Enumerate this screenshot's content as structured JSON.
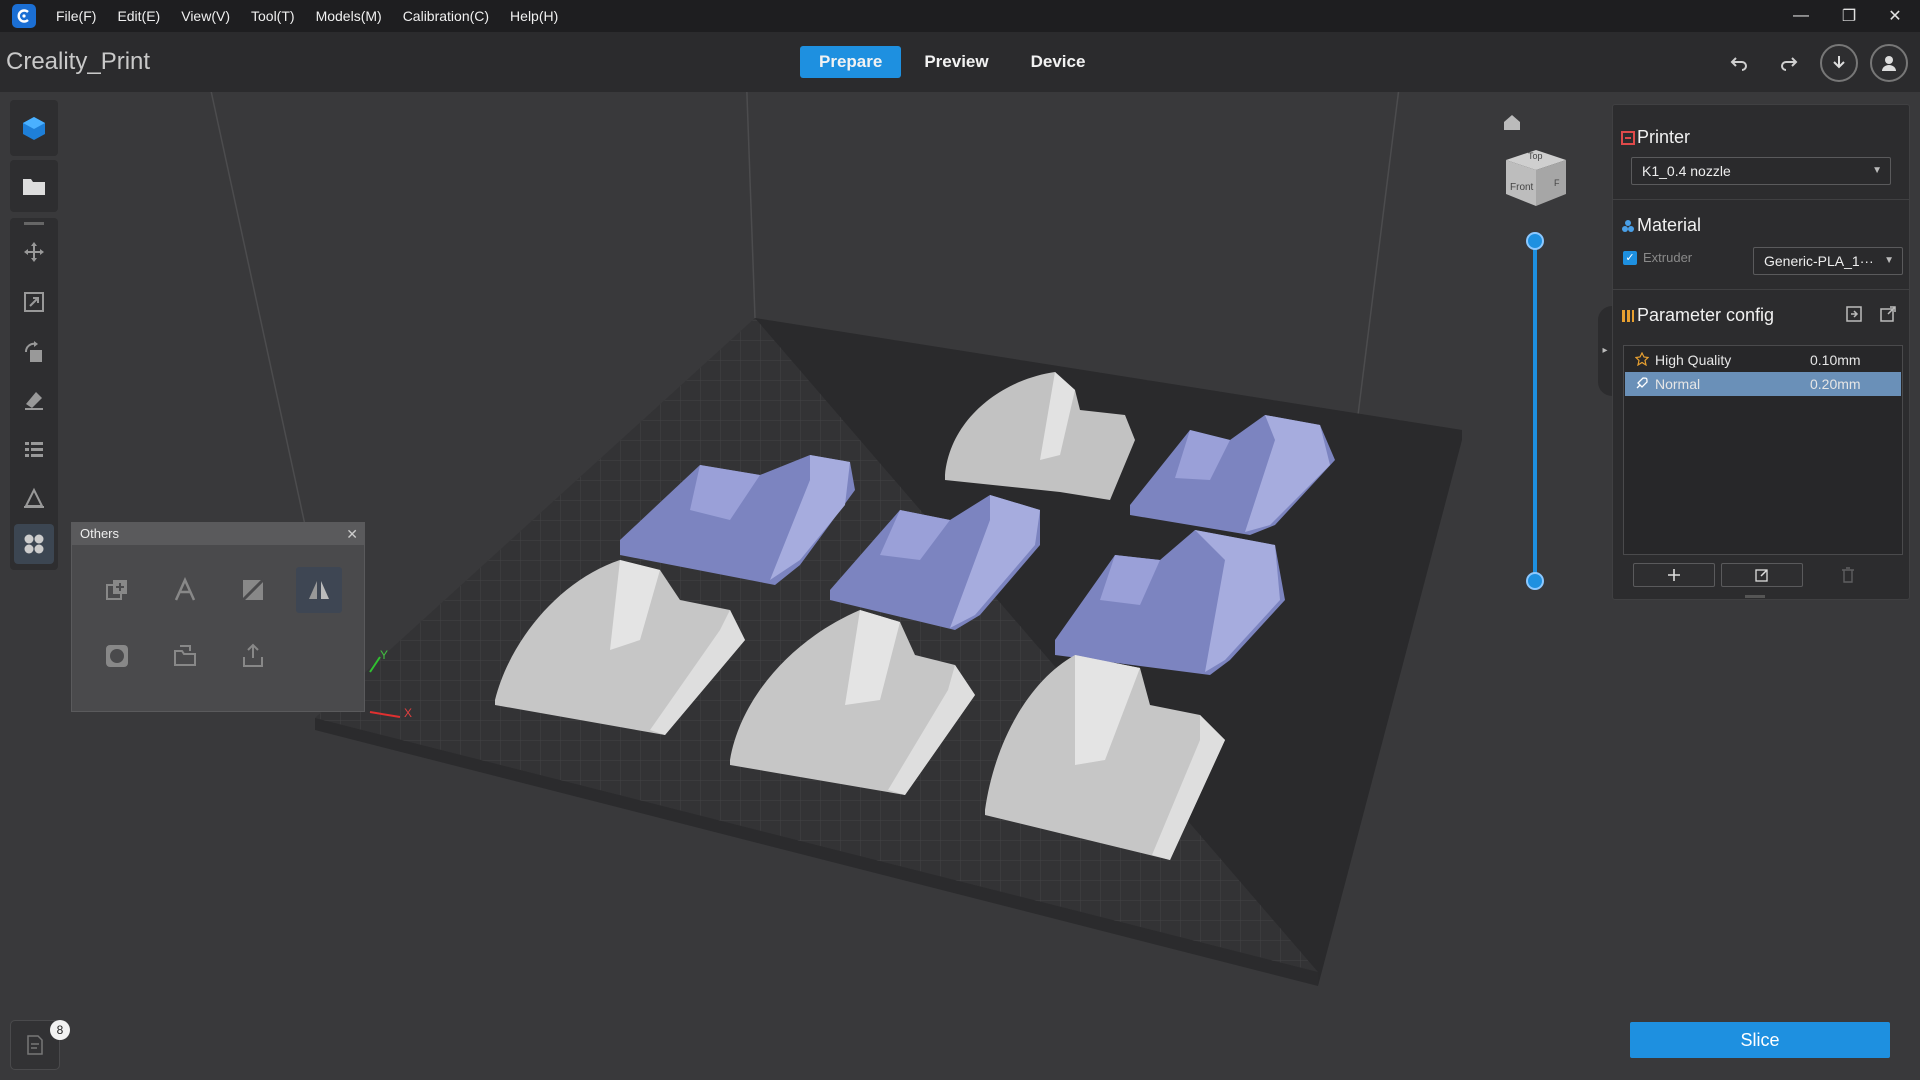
{
  "app": {
    "project_name": "Creality_Print"
  },
  "menu": {
    "items": [
      {
        "label": "File(F)"
      },
      {
        "label": "Edit(E)"
      },
      {
        "label": "View(V)"
      },
      {
        "label": "Tool(T)"
      },
      {
        "label": "Models(M)"
      },
      {
        "label": "Calibration(C)"
      },
      {
        "label": "Help(H)"
      }
    ]
  },
  "window_controls": {
    "minimize": "—",
    "restore": "❐",
    "close": "✕"
  },
  "tabs": [
    {
      "label": "Prepare",
      "active": true
    },
    {
      "label": "Preview",
      "active": false
    },
    {
      "label": "Device",
      "active": false
    }
  ],
  "view_cube": {
    "top": "Top",
    "front": "Front",
    "side": "F"
  },
  "axes": {
    "x": "X",
    "y": "Y"
  },
  "others_panel": {
    "title": "Others",
    "close": "✕"
  },
  "printer": {
    "title": "Printer",
    "selected": "K1_0.4 nozzle"
  },
  "material": {
    "title": "Material",
    "extruder_label": "Extruder",
    "selected": "Generic-PLA_1···"
  },
  "parameter_config": {
    "title": "Parameter config",
    "profiles": [
      {
        "name": "High Quality",
        "value": "0.10mm",
        "selected": false
      },
      {
        "name": "Normal",
        "value": "0.20mm",
        "selected": true
      }
    ]
  },
  "slice": {
    "label": "Slice"
  },
  "doc": {
    "badge": "8"
  },
  "colors": {
    "accent": "#1e90e0",
    "model_blue": "#8088c8",
    "model_gray": "#c8c8c8"
  }
}
